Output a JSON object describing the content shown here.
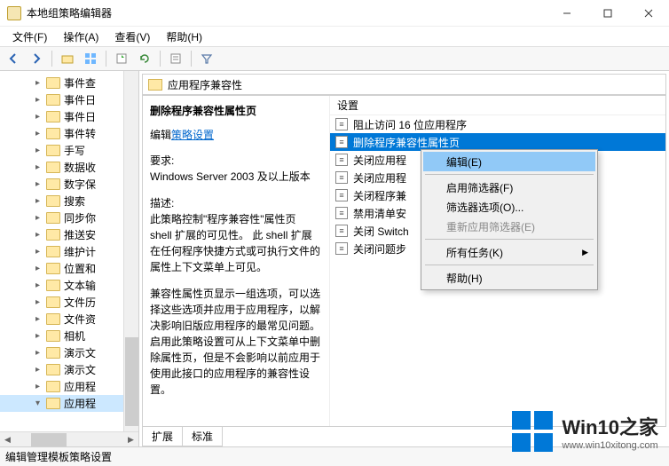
{
  "title": "本地组策略编辑器",
  "menu": {
    "file": "文件(F)",
    "action": "操作(A)",
    "view": "查看(V)",
    "help": "帮助(H)"
  },
  "tree": {
    "items": [
      "事件查",
      "事件日",
      "事件日",
      "事件转",
      "手写",
      "数据收",
      "数字保",
      "搜索",
      "同步你",
      "推送安",
      "维护计",
      "位置和",
      "文本输",
      "文件历",
      "文件资",
      "相机",
      "演示文",
      "演示文",
      "应用程",
      "应用程"
    ],
    "selected_index": 19
  },
  "header": {
    "title": "应用程序兼容性"
  },
  "desc": {
    "title": "删除程序兼容性属性页",
    "edit_prefix": "编辑",
    "edit_link": "策略设置",
    "req_label": "要求:",
    "req_value": "Windows Server 2003 及以上版本",
    "desc_label": "描述:",
    "desc_body1": "此策略控制\"程序兼容性\"属性页 shell 扩展的可见性。  此 shell 扩展在任何程序快捷方式或可执行文件的属性上下文菜单上可见。",
    "desc_body2": "兼容性属性页显示一组选项，可以选择这些选项并应用于应用程序，以解决影响旧版应用程序的最常见问题。 启用此策略设置可从上下文菜单中删除属性页，但是不会影响以前应用于使用此接口的应用程序的兼容性设置。"
  },
  "settings": {
    "column": "设置",
    "rows": [
      "阻止访问 16 位应用程序",
      "删除程序兼容性属性页",
      "关闭应用程",
      "关闭应用程",
      "关闭程序兼",
      "禁用清单安",
      "关闭 Switch",
      "关闭问题步"
    ],
    "selected_index": 1
  },
  "context_menu": {
    "items": [
      {
        "label": "编辑(E)",
        "hl": true
      },
      {
        "sep": true
      },
      {
        "label": "启用筛选器(F)"
      },
      {
        "label": "筛选器选项(O)..."
      },
      {
        "label": "重新应用筛选器(E)",
        "disabled": true
      },
      {
        "sep": true
      },
      {
        "label": "所有任务(K)",
        "sub": true
      },
      {
        "sep": true
      },
      {
        "label": "帮助(H)"
      }
    ]
  },
  "tabs": {
    "ext": "扩展",
    "std": "标准"
  },
  "status": "编辑管理模板策略设置",
  "wm": {
    "name": "Win10之家",
    "url": "www.win10xitong.com"
  }
}
